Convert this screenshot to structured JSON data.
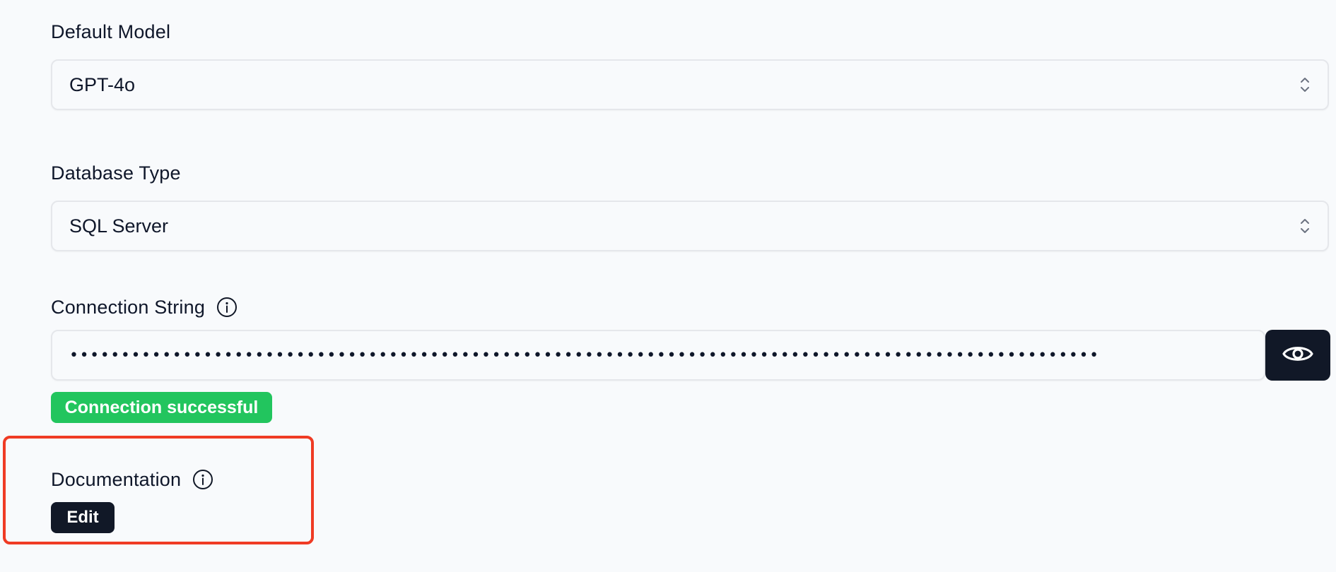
{
  "default_model": {
    "label": "Default Model",
    "value": "GPT-4o"
  },
  "database_type": {
    "label": "Database Type",
    "value": "SQL Server"
  },
  "connection_string": {
    "label": "Connection String",
    "info_icon": "info-icon",
    "masked_value": "••••••••••••••••••••••••••••••••••••••••••••••••••••••••••••••••••••••••••••••••••••••••••••••••••••",
    "toggle_icon": "eye-icon",
    "status": "Connection successful",
    "status_color": "#22c55e"
  },
  "documentation": {
    "label": "Documentation",
    "info_icon": "info-icon",
    "edit_label": "Edit",
    "highlight_color": "#ef3b24"
  }
}
